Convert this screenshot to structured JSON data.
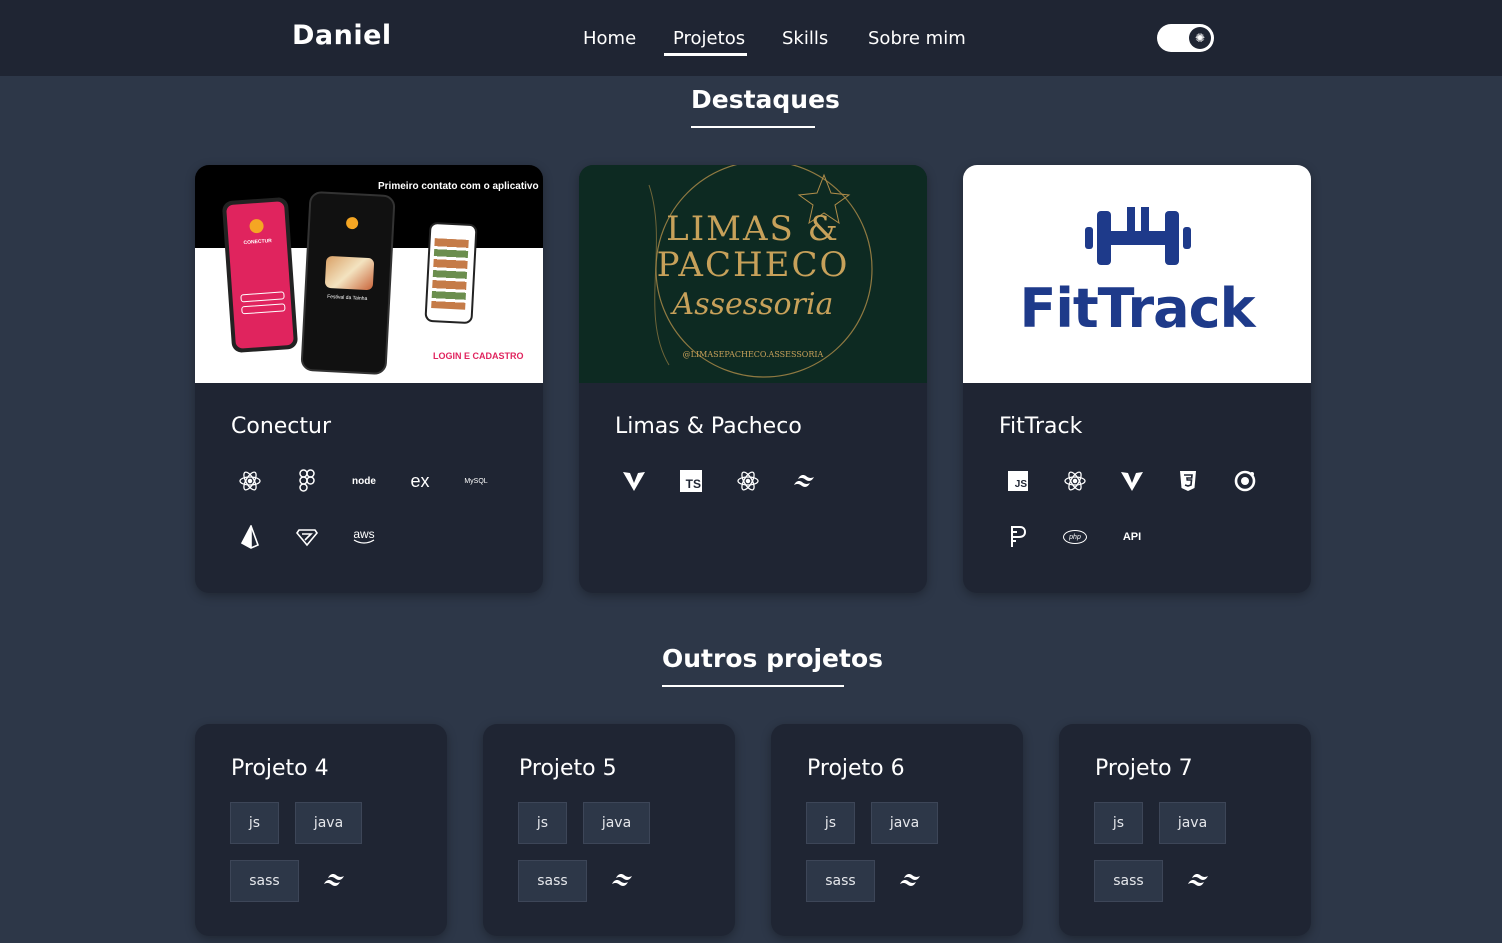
{
  "navbar": {
    "brand": "Daniel",
    "links": [
      "Home",
      "Projetos",
      "Skills",
      "Sobre mim"
    ],
    "active_link": "Projetos",
    "theme_toggle_icon": "sun-icon"
  },
  "featured": {
    "title": "Destaques",
    "cards": [
      {
        "title": "Conectur",
        "image_text": {
          "top": "Primeiro contato com o aplicativo",
          "bottom": "LOGIN E CADASTRO",
          "phone_brand": "CONECTUR",
          "phone_caption": "Festival da Tainha"
        },
        "tech_icons": [
          "react-icon",
          "figma-icon",
          "nodejs-icon",
          "express-icon",
          "mysql-icon",
          "prisma-icon",
          "zod-icon",
          "aws-icon"
        ],
        "tech_labels": {
          "node": "node",
          "express": "ex",
          "mysql": "MySQL",
          "aws": "aws"
        }
      },
      {
        "title": "Limas & Pacheco",
        "image_text": {
          "line1": "LIMAS &",
          "line2": "PACHECO",
          "script": "Assessoria",
          "handle": "@LIMASEPACHECO.ASSESSORIA"
        },
        "tech_icons": [
          "vite-icon",
          "typescript-icon",
          "react-icon",
          "tailwind-icon"
        ],
        "tech_labels": {
          "ts": "TS"
        }
      },
      {
        "title": "FitTrack",
        "image_text": {
          "logo": "FitTrack"
        },
        "tech_icons": [
          "javascript-icon",
          "react-icon",
          "vite-icon",
          "css3-icon",
          "ionic-icon",
          "pgadmin-icon",
          "php-icon",
          "api-icon"
        ],
        "tech_labels": {
          "js": "JS",
          "php": "php",
          "api": "API"
        }
      }
    ]
  },
  "others": {
    "title": "Outros projetos",
    "cards": [
      {
        "title": "Projeto 4",
        "chips": [
          "js",
          "java",
          "sass"
        ],
        "icon": "tailwind-icon"
      },
      {
        "title": "Projeto 5",
        "chips": [
          "js",
          "java",
          "sass"
        ],
        "icon": "tailwind-icon"
      },
      {
        "title": "Projeto 6",
        "chips": [
          "js",
          "java",
          "sass"
        ],
        "icon": "tailwind-icon"
      },
      {
        "title": "Projeto 7",
        "chips": [
          "js",
          "java",
          "sass"
        ],
        "icon": "tailwind-icon"
      }
    ]
  },
  "colors": {
    "background": "#2d3748",
    "surface": "#1f2533",
    "fittrack_blue": "#1e3a8a",
    "conectur_pink": "#e0245e",
    "limas_green": "#0d2a22",
    "limas_gold": "#b08d4a"
  }
}
